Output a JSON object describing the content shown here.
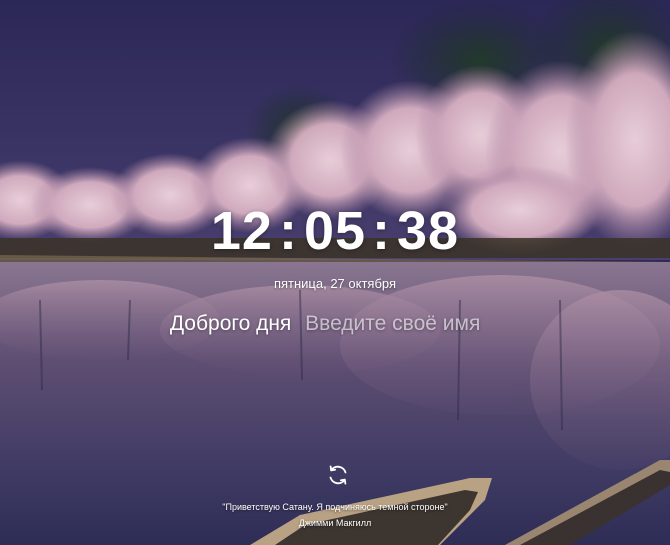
{
  "clock": {
    "hours": "12",
    "minutes": "05",
    "seconds": "38",
    "separator": ":"
  },
  "date": "пятница, 27 октября",
  "greeting": {
    "text": "Доброго дня",
    "name_placeholder": "Введите своё имя",
    "name_value": ""
  },
  "quote": {
    "text": "\"Приветствую Сатану. Я подчиняюсь темной стороне\"",
    "author": "Джимми Макгилл"
  },
  "icons": {
    "refresh": "refresh-icon"
  },
  "colors": {
    "text": "#ffffff",
    "placeholder": "#e6e1ee",
    "sky_top": "#2b2757",
    "blossom": "#e8c7d2",
    "water": "#5a4b6a"
  }
}
